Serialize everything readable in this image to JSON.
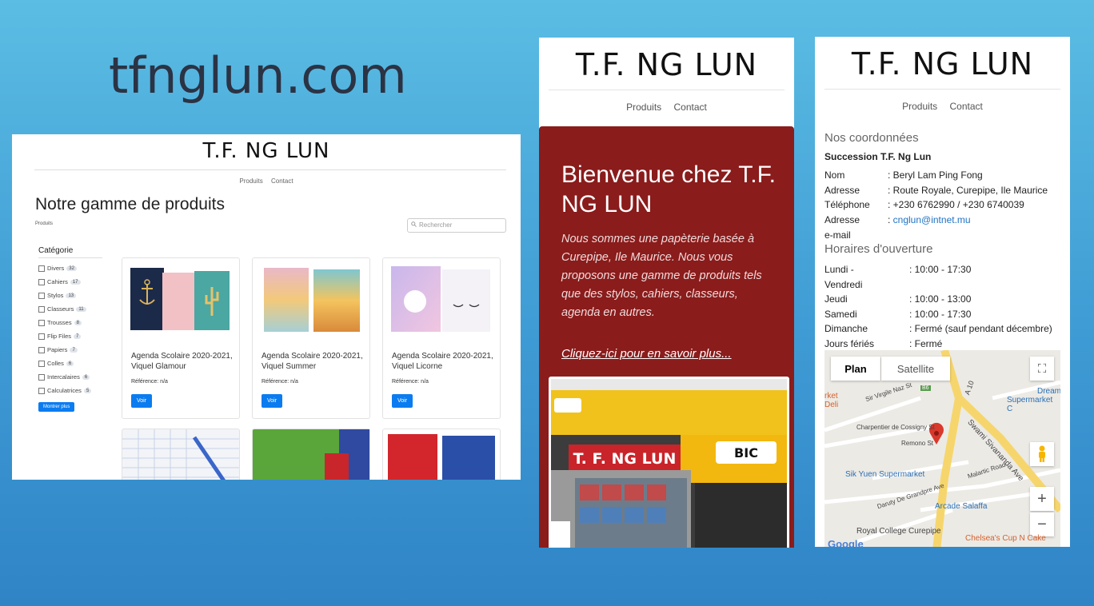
{
  "slide_title": "tfnglun.com",
  "desktop": {
    "brand": "T.F. NG LUN",
    "nav": [
      "Produits",
      "Contact"
    ],
    "heading": "Notre gamme de produits",
    "breadcrumb": "Produits",
    "search_placeholder": "Rechercher",
    "category_title": "Catégorie",
    "categories": [
      {
        "label": "Divers",
        "count": "32"
      },
      {
        "label": "Cahiers",
        "count": "17"
      },
      {
        "label": "Stylos",
        "count": "13"
      },
      {
        "label": "Classeurs",
        "count": "11"
      },
      {
        "label": "Trousses",
        "count": "8"
      },
      {
        "label": "Flip Files",
        "count": "7"
      },
      {
        "label": "Papiers",
        "count": "7"
      },
      {
        "label": "Colles",
        "count": "6"
      },
      {
        "label": "Intercalaires",
        "count": "6"
      },
      {
        "label": "Calculatrices",
        "count": "5"
      }
    ],
    "more_button": "Montrer plus",
    "products": [
      {
        "name": "Agenda Scolaire 2020-2021, Viquel Glamour",
        "ref": "Référence: n/a",
        "button": "Voir"
      },
      {
        "name": "Agenda Scolaire 2020-2021, Viquel Summer",
        "ref": "Référence: n/a",
        "button": "Voir"
      },
      {
        "name": "Agenda Scolaire 2020-2021, Viquel Licorne",
        "ref": "Référence: n/a",
        "button": "Voir"
      }
    ]
  },
  "mobile_home": {
    "brand": "T.F. NG LUN",
    "nav": [
      "Produits",
      "Contact"
    ],
    "hero_title": "Bienvenue chez T.F. NG LUN",
    "hero_text": "Nous sommes une papèterie basée à Curepipe, Ile Maurice. Nous vous proposons une gamme de produits tels que des stylos, cahiers, classeurs, agenda en autres.",
    "hero_link": "Cliquez-ici pour en savoir plus...",
    "shop_sign": "T. F. NG LUN",
    "shop_brand": "BIC"
  },
  "mobile_contact": {
    "brand": "T.F. NG LUN",
    "nav": [
      "Produits",
      "Contact"
    ],
    "coords_title": "Nos coordonnées",
    "company": "Succession T.F. Ng Lun",
    "coords": [
      {
        "k": "Nom",
        "v": ": Beryl Lam Ping Fong"
      },
      {
        "k": "Adresse",
        "v": ": Route Royale, Curepipe, Ile Maurice"
      },
      {
        "k": "Téléphone",
        "v": ": +230 6762990 / +230 6740039"
      }
    ],
    "email_label_1": "Adresse",
    "email_label_2": "e-mail",
    "email_prefix": ": ",
    "email": "cnglun@intnet.mu",
    "hours_title": "Horaires d'ouverture",
    "hours": [
      {
        "k": "Lundi -",
        "v": ": 10:00 - 17:30"
      },
      {
        "k": "Vendredi",
        "v": ""
      },
      {
        "k": "Jeudi",
        "v": ": 10:00 - 13:00"
      },
      {
        "k": "Samedi",
        "v": ": 10:00 - 17:30"
      },
      {
        "k": "Dimanche",
        "v": ": Fermé (sauf pendant décembre)"
      },
      {
        "k": "Jours fériés",
        "v": ": Fermé"
      }
    ],
    "map": {
      "tab_plan": "Plan",
      "tab_satellite": "Satellite",
      "labels": {
        "dream": "Dream",
        "supermarket": "Supermarket C",
        "market": "rket",
        "deli": "Deli",
        "virgile": "Sir Virgile Naz St",
        "b6": "B6",
        "a10": "A 10",
        "cossigny": "Charpentier de Cossigny St",
        "remono": "Remono St",
        "sivananda": "Swami Sivananda Ave",
        "malartic": "Malartic Road",
        "sikyuen": "Sik Yuen Supermarket",
        "grandpre": "Daruty De Grandpre Ave",
        "salaffa": "Arcade Salaffa",
        "royal": "Royal College Curepipe",
        "chelsea": "Chelsea's Cup N Cake",
        "google": "Google"
      }
    }
  }
}
